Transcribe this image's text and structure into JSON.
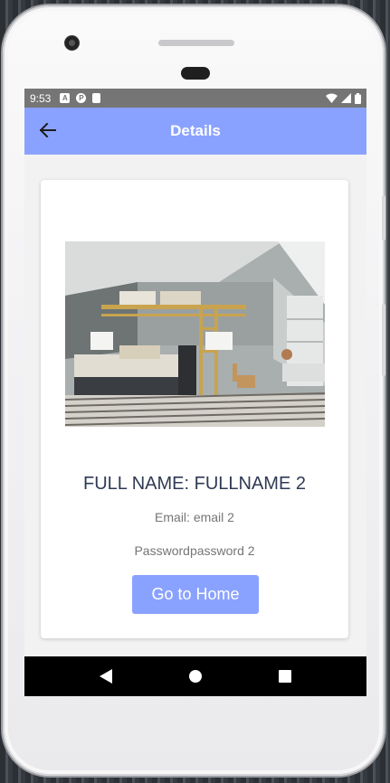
{
  "status_bar": {
    "time": "9:53",
    "icons": [
      "a-icon",
      "badge-icon",
      "sd-card-icon"
    ],
    "right_icons": [
      "wifi-icon",
      "signal-icon",
      "battery-icon"
    ]
  },
  "app_bar": {
    "title": "Details",
    "back_icon": "arrow-left-icon",
    "color": "#8aa2ff"
  },
  "detail": {
    "image": "bedroom-photo",
    "full_name": "FULL NAME: FULLNAME 2",
    "email": "Email: email 2",
    "password": "Passwordpassword 2",
    "home_button_label": "Go to Home"
  },
  "nav_bar": {
    "icons": [
      "back-triangle-icon",
      "home-circle-icon",
      "recents-square-icon"
    ]
  }
}
